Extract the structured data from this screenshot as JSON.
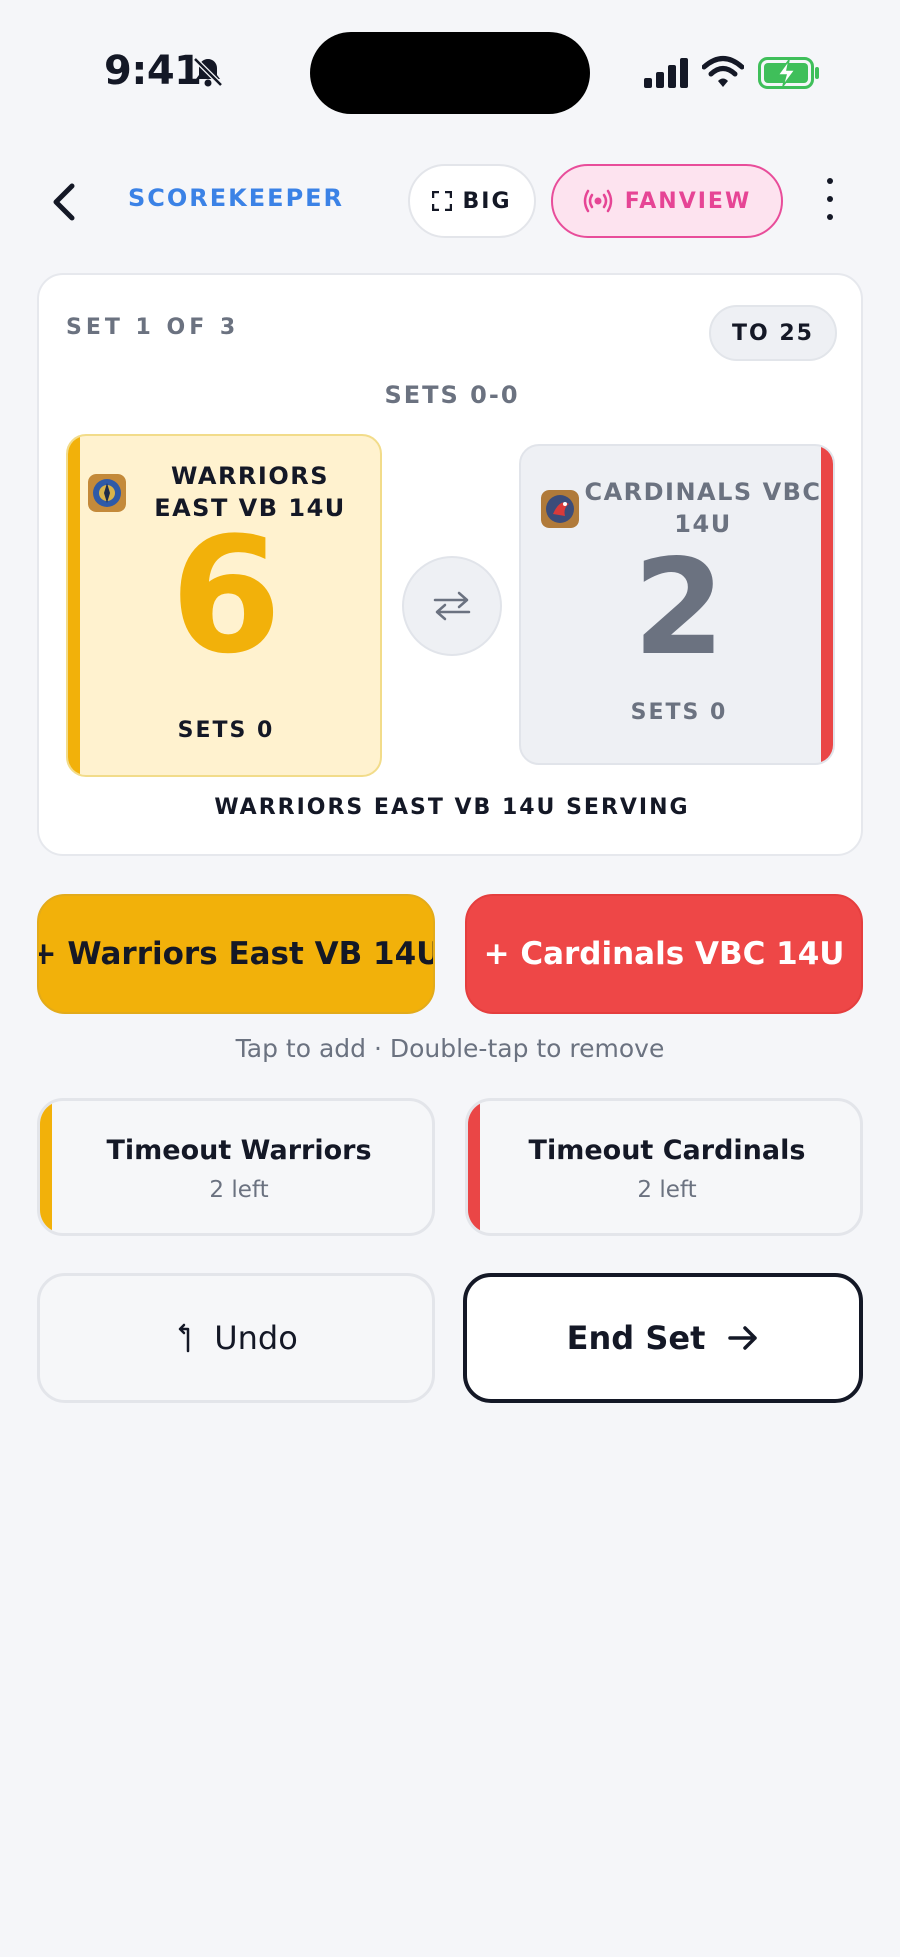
{
  "status_bar": {
    "time": "9:41",
    "icons": [
      "bell-muted-icon",
      "cellular-signal-icon",
      "wifi-icon",
      "battery-charging-icon"
    ]
  },
  "nav": {
    "title": "SCOREKEEPER",
    "big_label": "BIG",
    "fanview_label": "FANVIEW"
  },
  "scoreboard": {
    "set_label": "SET 1 OF 3",
    "target_label": "TO 25",
    "sets_summary": "SETS 0-0",
    "team_a": {
      "name": "WARRIORS EAST VB 14U",
      "score": "6",
      "sets": "SETS 0",
      "color": "#f2b10a"
    },
    "team_b": {
      "name": "CARDINALS VBC 14U",
      "score": "2",
      "sets": "SETS 0",
      "color": "#ea4646"
    },
    "serving_text": "WARRIORS EAST VB 14U SERVING"
  },
  "actions": {
    "point_a_label": "+ Warriors East VB 14U",
    "point_b_label": "+ Cardinals VBC 14U",
    "hint": "Tap to add · Double-tap to remove",
    "timeout_a": {
      "title": "Timeout Warriors",
      "remaining": "2 left"
    },
    "timeout_b": {
      "title": "Timeout Cardinals",
      "remaining": "2 left"
    },
    "undo_label": "Undo",
    "end_set_label": "End Set"
  }
}
